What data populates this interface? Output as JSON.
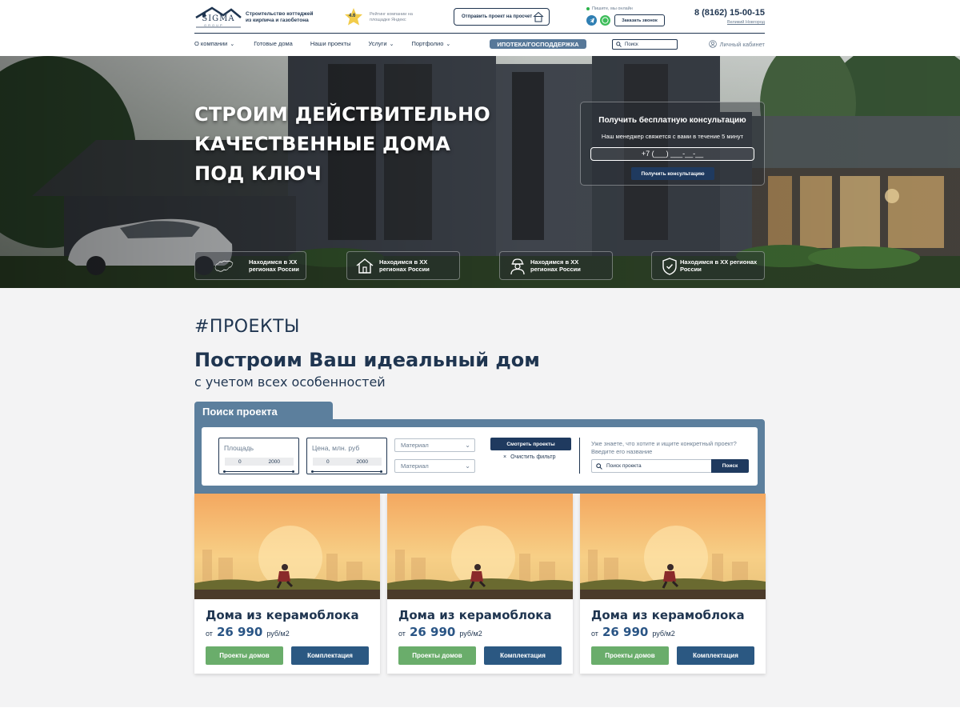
{
  "header": {
    "logo_text": "SIGMA",
    "logo_sub": "GROUP",
    "tagline": "Строительство коттеджей из кирпича и газобетона",
    "rating_value": "4.6",
    "rating_text": "Рейтинг компании на площадке Яндекс",
    "send_project": "Отправить проект на просчет",
    "online_text": "Пишите, мы онлайн",
    "call_button": "Заказать звонок",
    "phone": "8 (8162) 15-00-15",
    "city": "Великий Новгород"
  },
  "nav": {
    "items": [
      {
        "label": "О компании",
        "has_dropdown": true
      },
      {
        "label": "Готовые дома",
        "has_dropdown": false
      },
      {
        "label": "Наши проекты",
        "has_dropdown": false
      },
      {
        "label": "Услуги",
        "has_dropdown": true
      },
      {
        "label": "Портфолио",
        "has_dropdown": true
      }
    ],
    "mortgage": "ИПОТЕКА/ГОСПОДДЕРЖКА",
    "search_placeholder": "Поиск",
    "cabinet": "Личный кабинет"
  },
  "hero": {
    "title_lines": [
      "СТРОИМ ДЕЙСТВИТЕЛЬНО",
      "КАЧЕСТВЕННЫЕ ДОМА",
      "ПОД КЛЮЧ"
    ],
    "consult": {
      "title": "Получить бесплатную консультацию",
      "subtitle": "Наш менеджер свяжется с вами в течение 5 минут",
      "phone_placeholder": "+7 (___) ___-__-__",
      "button": "Получить консультацию"
    },
    "features": [
      {
        "icon": "russia-map-icon",
        "text": "Находимся в XX регионах России"
      },
      {
        "icon": "house-icon",
        "text": "Находимся в XX регионах России"
      },
      {
        "icon": "worker-icon",
        "text": "Находимся в XX регионах России"
      },
      {
        "icon": "shield-check-icon",
        "text": "Находимся в XX регионах России"
      }
    ]
  },
  "projects": {
    "tag": "#ПРОЕКТЫ",
    "title": "Построим Ваш идеальный дом",
    "subtitle": "с учетом всех особенностей",
    "filter": {
      "tab": "Поиск проекта",
      "area": {
        "label": "Площадь",
        "min": "0",
        "max": "2000"
      },
      "price": {
        "label": "Цена, млн. руб",
        "min": "0",
        "max": "2000"
      },
      "material_1": "Материал",
      "material_2": "Материал",
      "show_button": "Смотреть проекты",
      "clear": "Очистить фильтр",
      "know_text": "Уже знаете, что хотите и ищите конкретный проект? Введите его название",
      "search_placeholder": "Поиск проекта",
      "search_button": "Поиск"
    },
    "cards": [
      {
        "title": "Дома из керамоблока",
        "from": "от",
        "price": "26 990",
        "unit": "руб/м2",
        "btn_projects": "Проекты домов",
        "btn_config": "Комплектация"
      },
      {
        "title": "Дома из керамоблока",
        "from": "от",
        "price": "26 990",
        "unit": "руб/м2",
        "btn_projects": "Проекты домов",
        "btn_config": "Комплектация"
      },
      {
        "title": "Дома из керамоблока",
        "from": "от",
        "price": "26 990",
        "unit": "руб/м2",
        "btn_projects": "Проекты домов",
        "btn_config": "Комплектация"
      }
    ]
  },
  "colors": {
    "primary": "#1f3550",
    "accent_blue": "#2b5882",
    "panel_blue": "#5c7f9d",
    "green": "#6aad6b"
  }
}
